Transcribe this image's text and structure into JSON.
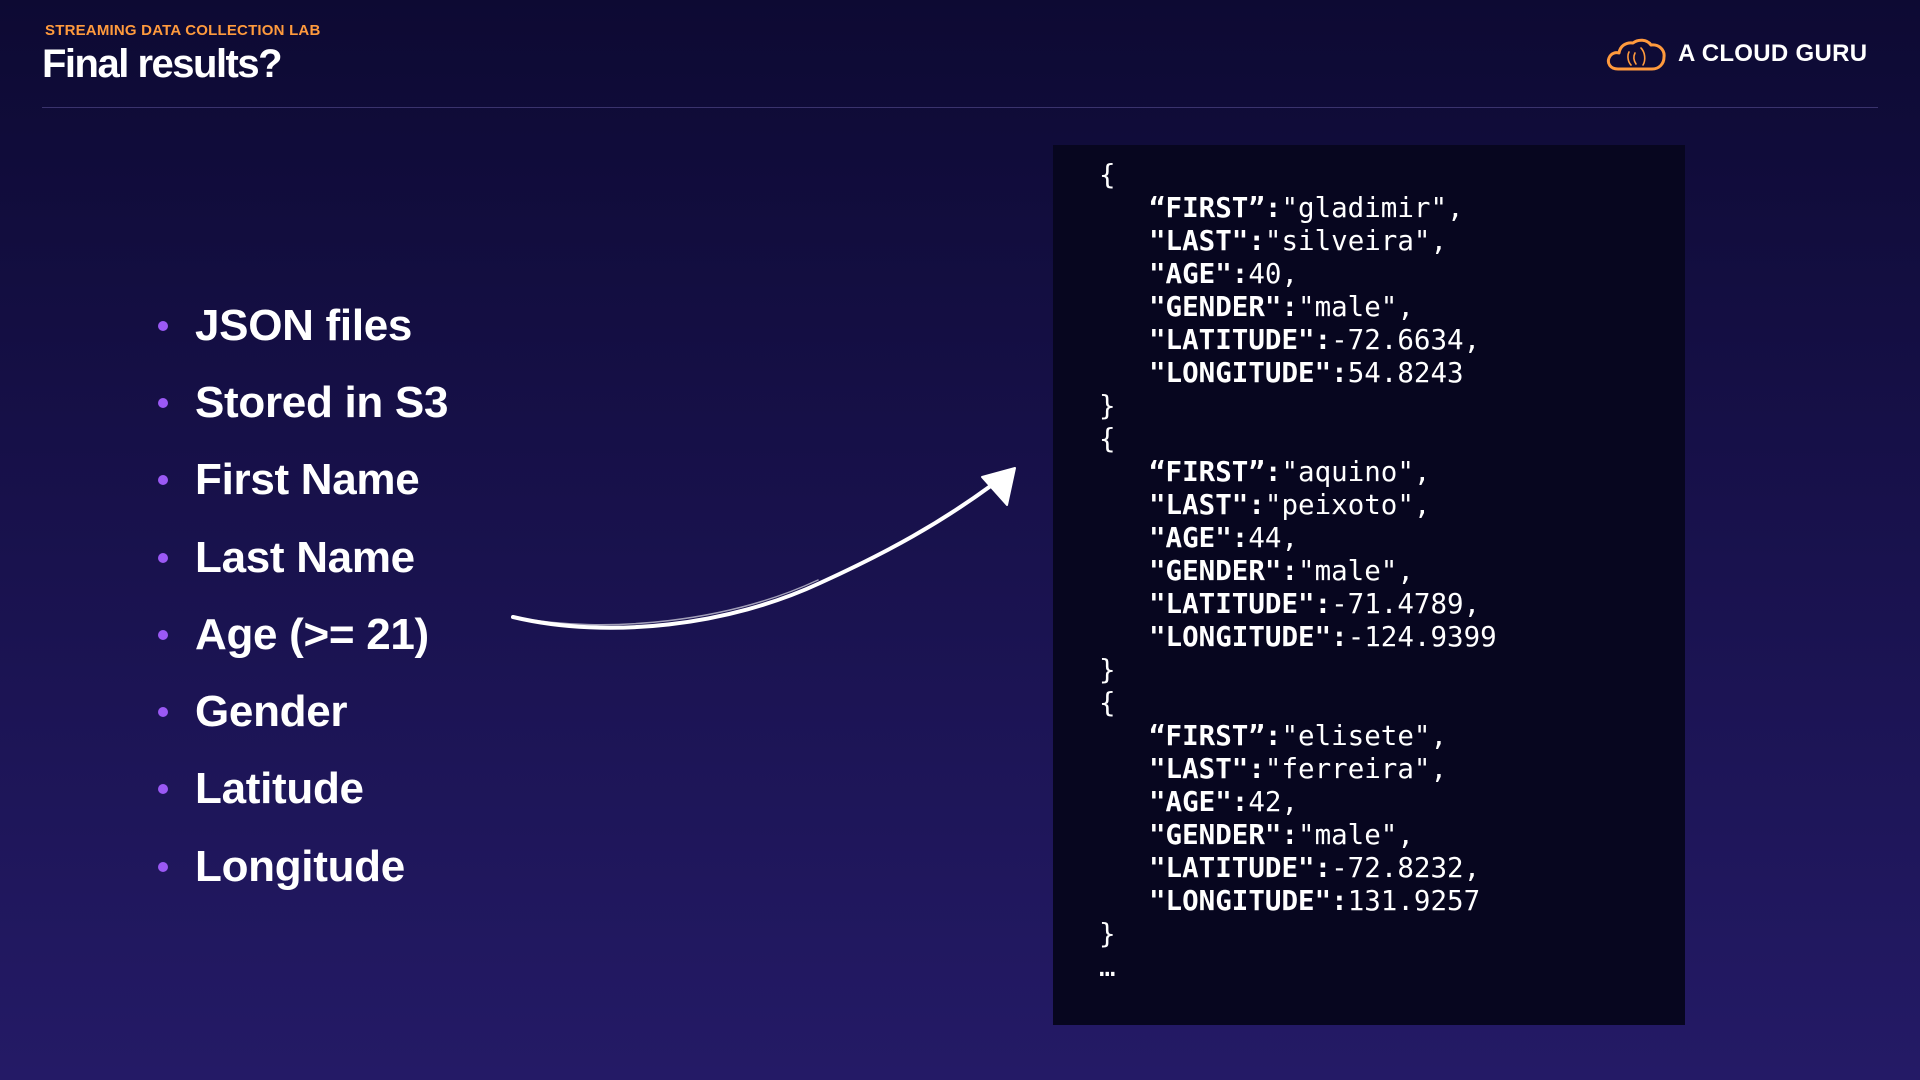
{
  "header": {
    "eyebrow": "STREAMING DATA COLLECTION LAB",
    "title": "Final results?",
    "brand": "A CLOUD GURU",
    "brand_icon": "cloud-icon",
    "accent_color": "#ff9a3d"
  },
  "bullets": [
    "JSON files",
    "Stored in S3",
    "First Name",
    "Last Name",
    "Age (>= 21)",
    "Gender",
    "Latitude",
    "Longitude"
  ],
  "bullet_color": "#9b59f5",
  "records": [
    {
      "first": "\"gladimir\",",
      "last": "\"silveira\",",
      "age": "40,",
      "gender": "\"male\",",
      "latitude": "-72.6634,",
      "longitude": "54.8243"
    },
    {
      "first": "\"aquino\",",
      "last": "\"peixoto\",",
      "age": "44,",
      "gender": "\"male\",",
      "latitude": "-71.4789,",
      "longitude": "-124.9399"
    },
    {
      "first": "\"elisete\",",
      "last": "\"ferreira\",",
      "age": "42,",
      "gender": "\"male\",",
      "latitude": "-72.8232,",
      "longitude": "131.9257"
    }
  ],
  "keys": {
    "first": "“FIRST”:",
    "last": "\"LAST\":",
    "age": "\"AGE\":",
    "gender": "\"GENDER\":",
    "latitude": "\"LATITUDE\":",
    "longitude": "\"LONGITUDE\":"
  },
  "open_brace": "{",
  "close_brace": "}",
  "ellipsis": "…"
}
